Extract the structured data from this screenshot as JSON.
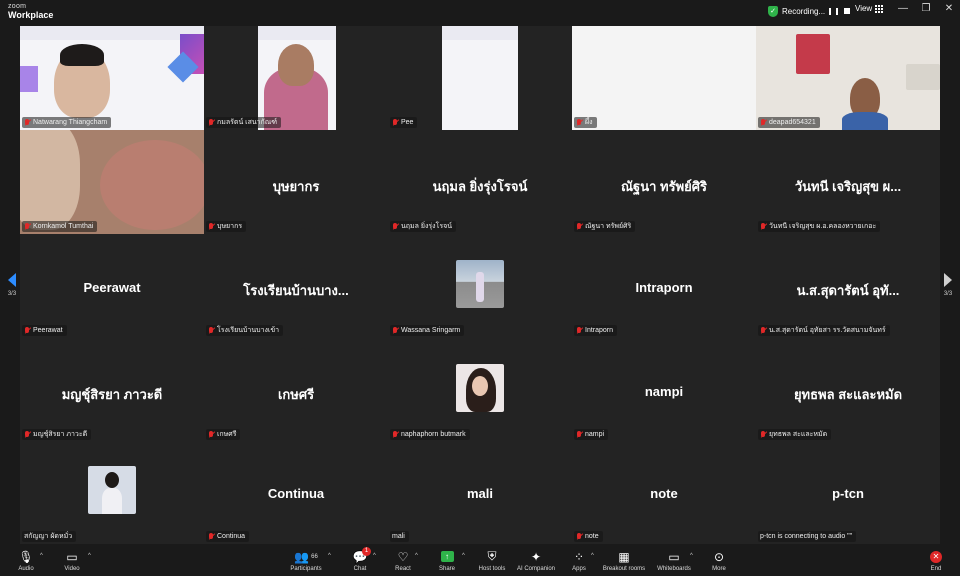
{
  "app": {
    "brand_top": "zoom",
    "brand_bottom": "Workplace"
  },
  "topbar": {
    "recording_label": "Recording...",
    "view_label": "View",
    "window_controls": [
      "—",
      "❐",
      "✕"
    ]
  },
  "pagination": {
    "left": "3/3",
    "right": "3/3"
  },
  "tiles": [
    {
      "label": "Natwarang Thiangcham",
      "display": "",
      "kind": "video"
    },
    {
      "label": "กมลรัตน์ เสนากัณฑ์",
      "display": "",
      "kind": "video"
    },
    {
      "label": "Pee",
      "display": "",
      "kind": "video"
    },
    {
      "label": "ผึ้ง",
      "display": "",
      "kind": "video"
    },
    {
      "label": "deapad654321",
      "display": "",
      "kind": "video"
    },
    {
      "label": "Kornkamol Tumthai",
      "display": "",
      "kind": "video"
    },
    {
      "label": "บุษยากร",
      "display": "บุษยากร",
      "kind": "name"
    },
    {
      "label": "นฤมล ยิ่งรุ่งโรจน์",
      "display": "นฤมล ยิ่งรุ่งโรจน์",
      "kind": "name"
    },
    {
      "label": "ณัฐนา ทรัพย์ศิริ",
      "display": "ณัฐนา ทรัพย์ศิริ",
      "kind": "name"
    },
    {
      "label": "วันทนี เจริญสุข ผ.อ.คลองหวายเกอะ",
      "display": "วันทนี เจริญสุข ผ...",
      "kind": "name"
    },
    {
      "label": "Peerawat",
      "display": "Peerawat",
      "kind": "name"
    },
    {
      "label": "โรงเรียนบ้านบางเข้า",
      "display": "โรงเรียนบ้านบาง...",
      "kind": "name"
    },
    {
      "label": "Wassana Sringarm",
      "display": "",
      "kind": "avatar"
    },
    {
      "label": "Intraporn",
      "display": "Intraporn",
      "kind": "name"
    },
    {
      "label": "น.ส.สุดารัตน์ อุทัยสา รร.วัดสนามจันทร์",
      "display": "น.ส.สุดารัตน์ อุทั...",
      "kind": "name"
    },
    {
      "label": "มญชุ์สิรยา ภาวะดี",
      "display": "มญชุ์สิรยา ภาวะดี",
      "kind": "name"
    },
    {
      "label": "เกษศรี",
      "display": "เกษศรี",
      "kind": "name"
    },
    {
      "label": "naphaphorn butmark",
      "display": "",
      "kind": "avatar"
    },
    {
      "label": "nampi",
      "display": "nampi",
      "kind": "name"
    },
    {
      "label": "ยุทธพล สะและหมัด",
      "display": "ยุทธพล สะและหมัด",
      "kind": "name"
    },
    {
      "label": "สกัญญา ผัดหมั่ว",
      "display": "",
      "kind": "avatar"
    },
    {
      "label": "Continua",
      "display": "Continua",
      "kind": "name"
    },
    {
      "label": "mali",
      "display": "mali",
      "kind": "name"
    },
    {
      "label": "note",
      "display": "note",
      "kind": "name"
    },
    {
      "label": "p-tcn is connecting to audio \"\"",
      "display": "p-tcn",
      "kind": "name"
    }
  ],
  "toolbar": {
    "audio": "Audio",
    "video": "Video",
    "participants": "Participants",
    "participants_count": "66",
    "chat": "Chat",
    "chat_badge": "1",
    "react": "React",
    "share": "Share",
    "host_tools": "Host tools",
    "ai_companion": "AI Companion",
    "apps": "Apps",
    "breakout_rooms": "Breakout rooms",
    "whiteboards": "Whiteboards",
    "more": "More",
    "end": "End"
  },
  "colors": {
    "accent": "#2d8cff",
    "muted_red": "#e02828",
    "share_green": "#2fb34a",
    "tile_bg": "#232323"
  }
}
